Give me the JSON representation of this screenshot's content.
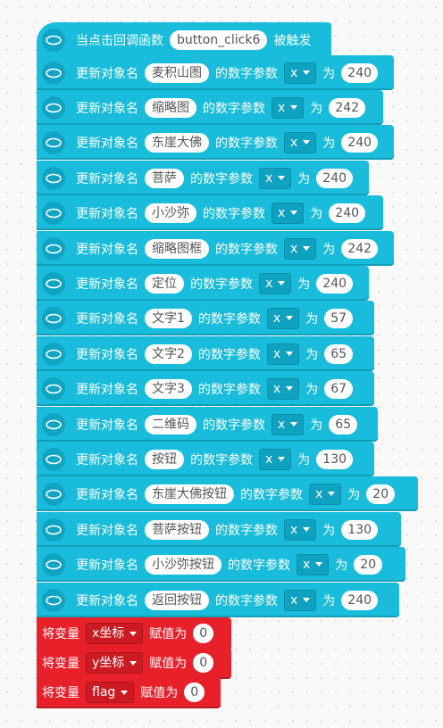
{
  "event": {
    "prefix": "当点击回调函数",
    "callback": "button_click6",
    "suffix": "被触发"
  },
  "update_blocks": [
    {
      "prefix": "更新对象名",
      "object": "麦积山图",
      "middle": "的数字参数",
      "param": "x",
      "to": "为",
      "value": "240"
    },
    {
      "prefix": "更新对象名",
      "object": "缩略图",
      "middle": "的数字参数",
      "param": "x",
      "to": "为",
      "value": "242"
    },
    {
      "prefix": "更新对象名",
      "object": "东崖大佛",
      "middle": "的数字参数",
      "param": "x",
      "to": "为",
      "value": "240"
    },
    {
      "prefix": "更新对象名",
      "object": "菩萨",
      "middle": "的数字参数",
      "param": "x",
      "to": "为",
      "value": "240"
    },
    {
      "prefix": "更新对象名",
      "object": "小沙弥",
      "middle": "的数字参数",
      "param": "x",
      "to": "为",
      "value": "240"
    },
    {
      "prefix": "更新对象名",
      "object": "缩略图框",
      "middle": "的数字参数",
      "param": "x",
      "to": "为",
      "value": "242"
    },
    {
      "prefix": "更新对象名",
      "object": "定位",
      "middle": "的数字参数",
      "param": "x",
      "to": "为",
      "value": "240"
    },
    {
      "prefix": "更新对象名",
      "object": "文字1",
      "middle": "的数字参数",
      "param": "x",
      "to": "为",
      "value": "57"
    },
    {
      "prefix": "更新对象名",
      "object": "文字2",
      "middle": "的数字参数",
      "param": "x",
      "to": "为",
      "value": "65"
    },
    {
      "prefix": "更新对象名",
      "object": "文字3",
      "middle": "的数字参数",
      "param": "x",
      "to": "为",
      "value": "67"
    },
    {
      "prefix": "更新对象名",
      "object": "二维码",
      "middle": "的数字参数",
      "param": "x",
      "to": "为",
      "value": "65"
    },
    {
      "prefix": "更新对象名",
      "object": "按钮",
      "middle": "的数字参数",
      "param": "x",
      "to": "为",
      "value": "130"
    },
    {
      "prefix": "更新对象名",
      "object": "东崖大佛按钮",
      "middle": "的数字参数",
      "param": "x",
      "to": "为",
      "value": "20"
    },
    {
      "prefix": "更新对象名",
      "object": "菩萨按钮",
      "middle": "的数字参数",
      "param": "x",
      "to": "为",
      "value": "130"
    },
    {
      "prefix": "更新对象名",
      "object": "小沙弥按钮",
      "middle": "的数字参数",
      "param": "x",
      "to": "为",
      "value": "20"
    },
    {
      "prefix": "更新对象名",
      "object": "返回按钮",
      "middle": "的数字参数",
      "param": "x",
      "to": "为",
      "value": "240"
    }
  ],
  "var_blocks": [
    {
      "prefix": "将变量",
      "var": "x坐标",
      "assign": "赋值为",
      "value": "0"
    },
    {
      "prefix": "将变量",
      "var": "y坐标",
      "assign": "赋值为",
      "value": "0"
    },
    {
      "prefix": "将变量",
      "var": "flag",
      "assign": "赋值为",
      "value": "0"
    }
  ],
  "colors": {
    "looks_block": "#19bcda",
    "variable_block": "#e8202a",
    "workspace": "#f9f9f9"
  },
  "icons": {
    "block_icon": "eye-ellipse-icon"
  }
}
